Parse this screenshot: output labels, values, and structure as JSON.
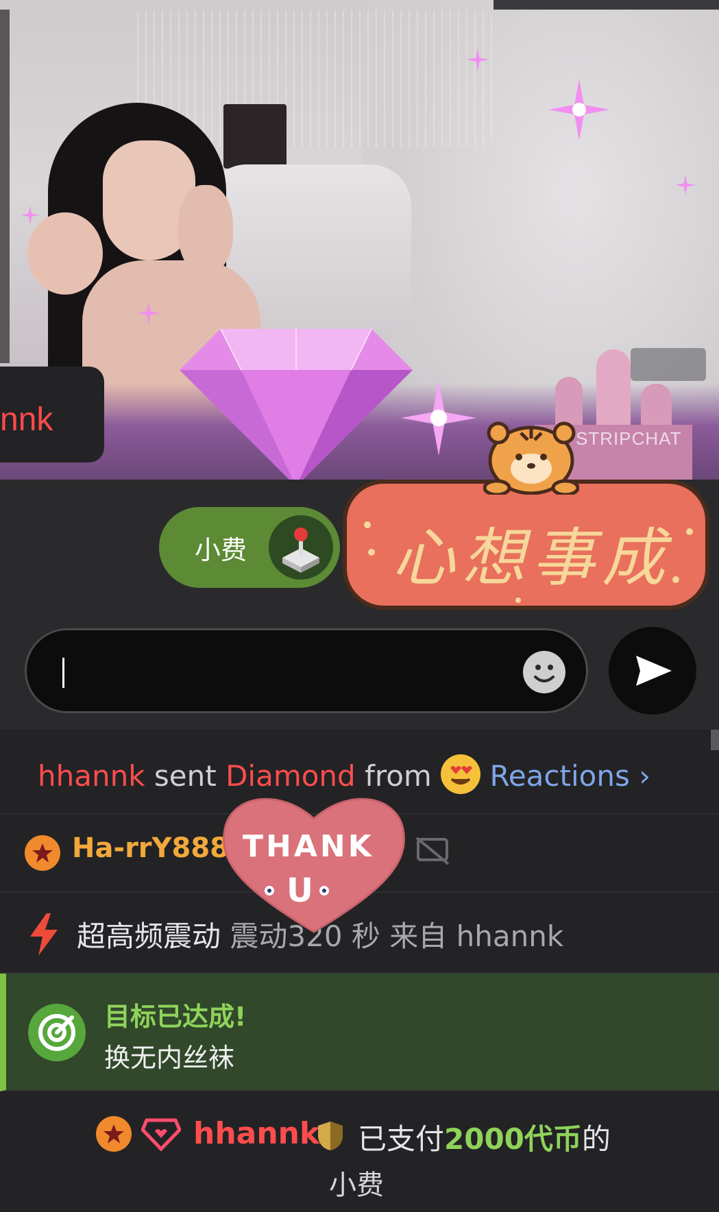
{
  "video": {
    "name_overlay": "nnk",
    "watermark": "STRIPCHAT"
  },
  "tip_bar": {
    "tip_label": "小费",
    "sticker_text": "心想事成"
  },
  "input": {
    "value": "",
    "placeholder": ""
  },
  "chat": {
    "reaction": {
      "user": "hhannk",
      "sent": "sent",
      "item": "Diamond",
      "from": "from",
      "source": "Reactions",
      "chevron": "›"
    },
    "user_row": {
      "username": "Ha-rrY888"
    },
    "thank_sticker": {
      "line1": "THANK",
      "line2": "U"
    },
    "vibration": {
      "title": "超高频震动",
      "detail": "震动320 秒",
      "from_label": "来自",
      "user": "hhannk"
    },
    "goal": {
      "title": "目标已达成!",
      "subtitle": "换无内丝袜"
    },
    "tip": {
      "user": "hhannk",
      "paid_prefix": "已支付",
      "amount": "2000代币",
      "paid_suffix": "的",
      "line2": "小费"
    }
  },
  "colors": {
    "accent_red": "#ff4d4d",
    "link_blue": "#7ea6e8",
    "tip_green": "#5d8a35",
    "goal_green": "#8fd35a",
    "username_orange": "#f2a93b"
  }
}
